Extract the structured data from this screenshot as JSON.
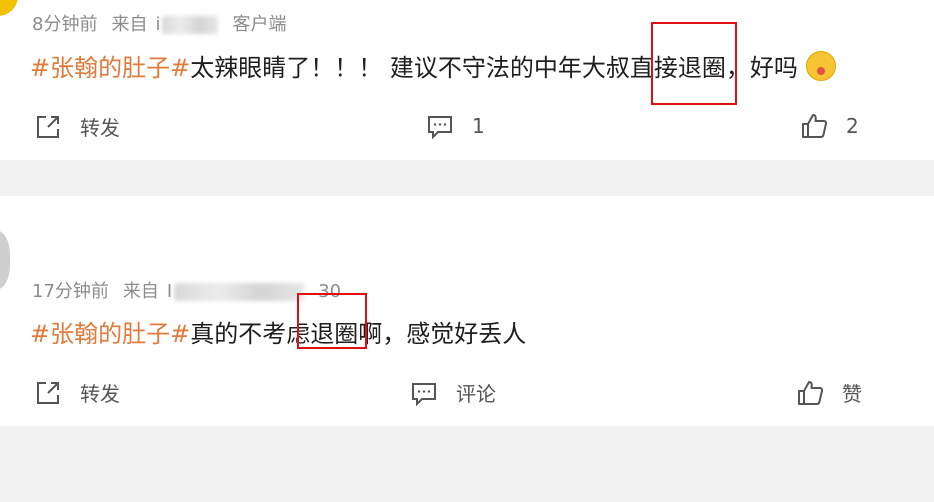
{
  "posts": [
    {
      "time": "8分钟前",
      "source_prefix": "来自",
      "source_visible_prefix": "i",
      "source_suffix": "客户端",
      "hashtag": "#张翰的肚子#",
      "text_before": "太辣眼睛了！！！ 建议不守法的中年大叔直接",
      "highlight": "退圈",
      "text_after": "，好吗",
      "emoji_icon": "face-savoring-food-emoji",
      "repost_label": "转发",
      "comment_label": "1",
      "like_label": "2"
    },
    {
      "time": "17分钟前",
      "source_prefix": "来自",
      "source_visible_prefix": "I",
      "source_suffix": "30",
      "hashtag": "#张翰的肚子#",
      "text_before": "真的不考虑",
      "highlight": "退圈",
      "text_after": "啊，感觉好丢人",
      "repost_label": "转发",
      "comment_label": "评论",
      "like_label": "赞"
    }
  ],
  "colors": {
    "hashtag": "#e07b3c",
    "highlight_box": "#e01010",
    "separator": "#f2f2f2",
    "meta_text": "#8c8c8c"
  },
  "icons": {
    "repost": "share-arrow-icon",
    "comment": "comment-bubble-icon",
    "like": "thumbs-up-icon"
  }
}
